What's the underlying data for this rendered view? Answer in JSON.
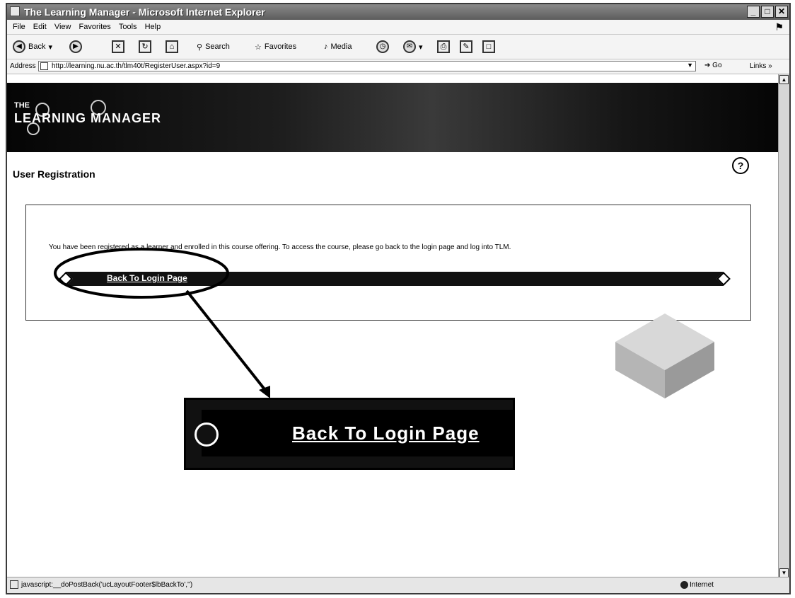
{
  "window": {
    "title": "The Learning Manager - Microsoft Internet Explorer",
    "controls": [
      "_",
      "□",
      "✕"
    ]
  },
  "menubar": {
    "items": [
      "File",
      "Edit",
      "View",
      "Favorites",
      "Tools",
      "Help"
    ]
  },
  "toolbar": {
    "back_label": "Back",
    "search_label": "Search",
    "favorites_label": "Favorites",
    "media_label": "Media"
  },
  "addressbar": {
    "label": "Address",
    "url": "http://learning.nu.ac.th/tlm40t/RegisterUser.aspx?id=9",
    "go_label": "Go",
    "links_label": "Links »"
  },
  "banner": {
    "the": "THE",
    "title": "LEARNING MANAGER"
  },
  "page": {
    "heading": "User Registration",
    "help_symbol": "?",
    "message": "You have been registered as a learner and enrolled in this course offering. To access the course, please go back to the login page and log into TLM.",
    "back_link": "Back To Login Page",
    "zoom_link": "Back To Login Page"
  },
  "statusbar": {
    "text": "javascript:__doPostBack('ucLayoutFooter$lbBackTo','')",
    "zone": "Internet"
  },
  "colors": {
    "banner_dark": "#111111",
    "annotation": "#000000"
  }
}
